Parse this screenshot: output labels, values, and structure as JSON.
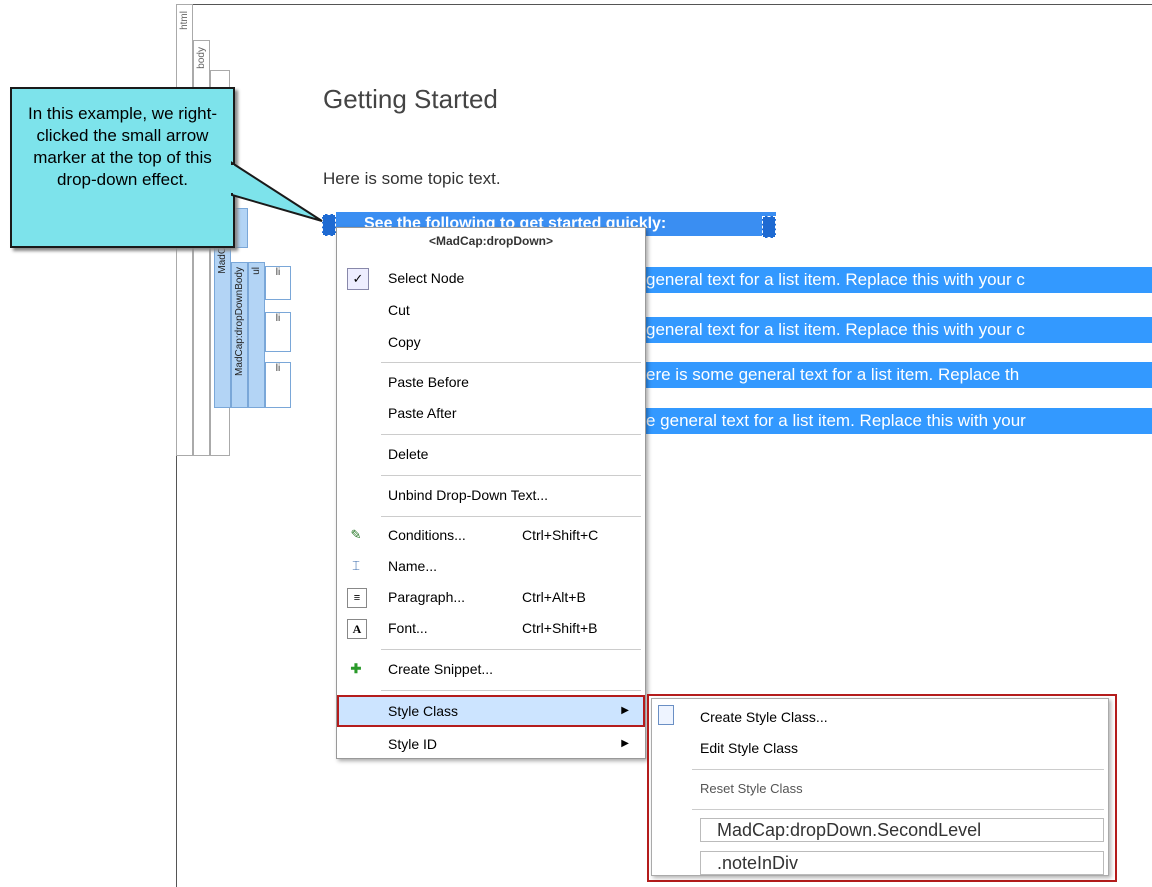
{
  "structure_bar": {
    "labels": [
      "html",
      "body",
      "MadCap:drop",
      "MadCap:dropDownBody",
      "ul",
      "li",
      "li",
      "li"
    ]
  },
  "document": {
    "title": "Getting Started",
    "paragraph": "Here is some topic text.",
    "dropdown_head": "See the following to get started quickly:",
    "list_items": [
      "general text for a list item. Replace this with your c",
      "general text for a list item. Replace this with your c",
      "ere is some general text for a list item. Replace th",
      "e general text for a list item. Replace this with your"
    ]
  },
  "callout": {
    "text": "In this example, we right-clicked the small arrow marker at the top of this drop-down effect.",
    "color": "#7de3eb"
  },
  "context_menu": {
    "title": "<MadCap:dropDown>",
    "items": [
      {
        "label": "Select Node",
        "checked": true
      },
      {
        "label": "Cut"
      },
      {
        "label": "Copy"
      },
      {
        "label": "Paste Before"
      },
      {
        "label": "Paste After"
      },
      {
        "label": "Delete"
      },
      {
        "label": "Unbind Drop-Down Text..."
      },
      {
        "label": "Conditions...",
        "shortcut": "Ctrl+Shift+C",
        "icon": "conditions-icon"
      },
      {
        "label": "Name...",
        "icon": "name-icon"
      },
      {
        "label": "Paragraph...",
        "shortcut": "Ctrl+Alt+B",
        "icon": "paragraph-icon"
      },
      {
        "label": "Font...",
        "shortcut": "Ctrl+Shift+B",
        "icon": "font-icon"
      },
      {
        "label": "Create Snippet...",
        "icon": "snippet-icon"
      },
      {
        "label": "Style Class",
        "submenu": true,
        "highlighted": true
      },
      {
        "label": "Style ID",
        "submenu": true
      }
    ]
  },
  "submenu": {
    "items": [
      {
        "label": "Create Style Class...",
        "icon": "style-class-icon"
      },
      {
        "label": "Edit Style Class"
      },
      {
        "label": "Reset Style Class",
        "disabled": true
      }
    ],
    "classes": [
      "MadCap:dropDown.SecondLevel",
      ".noteInDiv"
    ]
  },
  "colors": {
    "selection": "#3399ff",
    "highlight_border": "#b41c1c",
    "structure_bar": "#b3d4f5"
  }
}
